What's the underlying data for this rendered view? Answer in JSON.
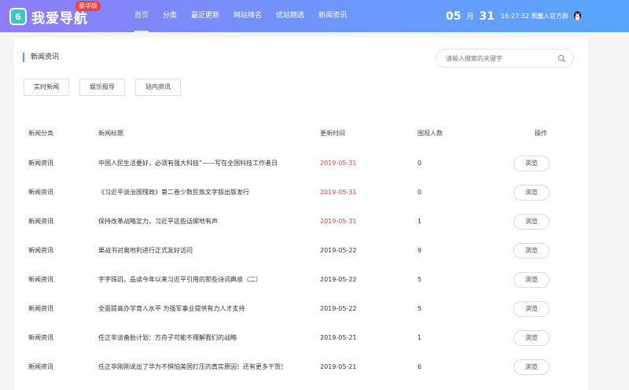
{
  "header": {
    "logo_mark": "6",
    "logo_text": "我爱导航",
    "logo_badge": "豪华版",
    "nav": [
      {
        "label": "首页",
        "active": true
      },
      {
        "label": "分类",
        "active": false
      },
      {
        "label": "最近更新",
        "active": false
      },
      {
        "label": "网站排名",
        "active": false
      },
      {
        "label": "优站精选",
        "active": false
      },
      {
        "label": "新闻资讯",
        "active": false
      }
    ],
    "date": {
      "month": "05",
      "month_unit": "月",
      "day": "31",
      "time": "16:27:32 周五"
    },
    "join_label": "加入官方群"
  },
  "main": {
    "title": "新闻资讯",
    "search": {
      "placeholder": "请输入搜索的关键字",
      "value": ""
    },
    "tabs": [
      "实时新闻",
      "娱乐报导",
      "站内资讯"
    ],
    "table": {
      "columns": [
        "新闻分类",
        "新闻标题",
        "更新时间",
        "围观人数",
        "操作"
      ],
      "button_label": "浏览",
      "rows": [
        {
          "category": "新闻资讯",
          "title": "中国人民生活要好，必须有强大科技”——写在全国科技工作者日",
          "date": "2019-05-31",
          "views": "0",
          "recent": true
        },
        {
          "category": "新闻资讯",
          "title": "《习近平谈治国理政》第二卷少数民族文字版出版发行",
          "date": "2019-05-31",
          "views": "0",
          "recent": true
        },
        {
          "category": "新闻资讯",
          "title": "保持改革战略定力，习近平这些话掷地有声",
          "date": "2019-05-31",
          "views": "1",
          "recent": true
        },
        {
          "category": "新闻资讯",
          "title": "栗战书对奥地利进行正式友好访问",
          "date": "2019-05-22",
          "views": "9",
          "recent": false
        },
        {
          "category": "新闻资讯",
          "title": "字字珠玑，品读今年以来习近平引用的那些诗词典故（二）",
          "date": "2019-05-22",
          "views": "5",
          "recent": false
        },
        {
          "category": "新闻资讯",
          "title": "全面提高办学育人水平 为强军事业提供有力人才支持",
          "date": "2019-05-22",
          "views": "5",
          "recent": false
        },
        {
          "category": "新闻资讯",
          "title": "任正非谈备胎计划：方舟子可能不理解我们的战略",
          "date": "2019-05-21",
          "views": "1",
          "recent": false
        },
        {
          "category": "新闻资讯",
          "title": "任正非刚刚说出了华为不惧怕美国打压的真实原因！还有更多干货！",
          "date": "2019-05-21",
          "views": "6",
          "recent": false
        }
      ]
    }
  },
  "colors": {
    "accent": "#4aa3f5",
    "recent_date": "#e84545",
    "nav_active": "#d7f7c6"
  }
}
